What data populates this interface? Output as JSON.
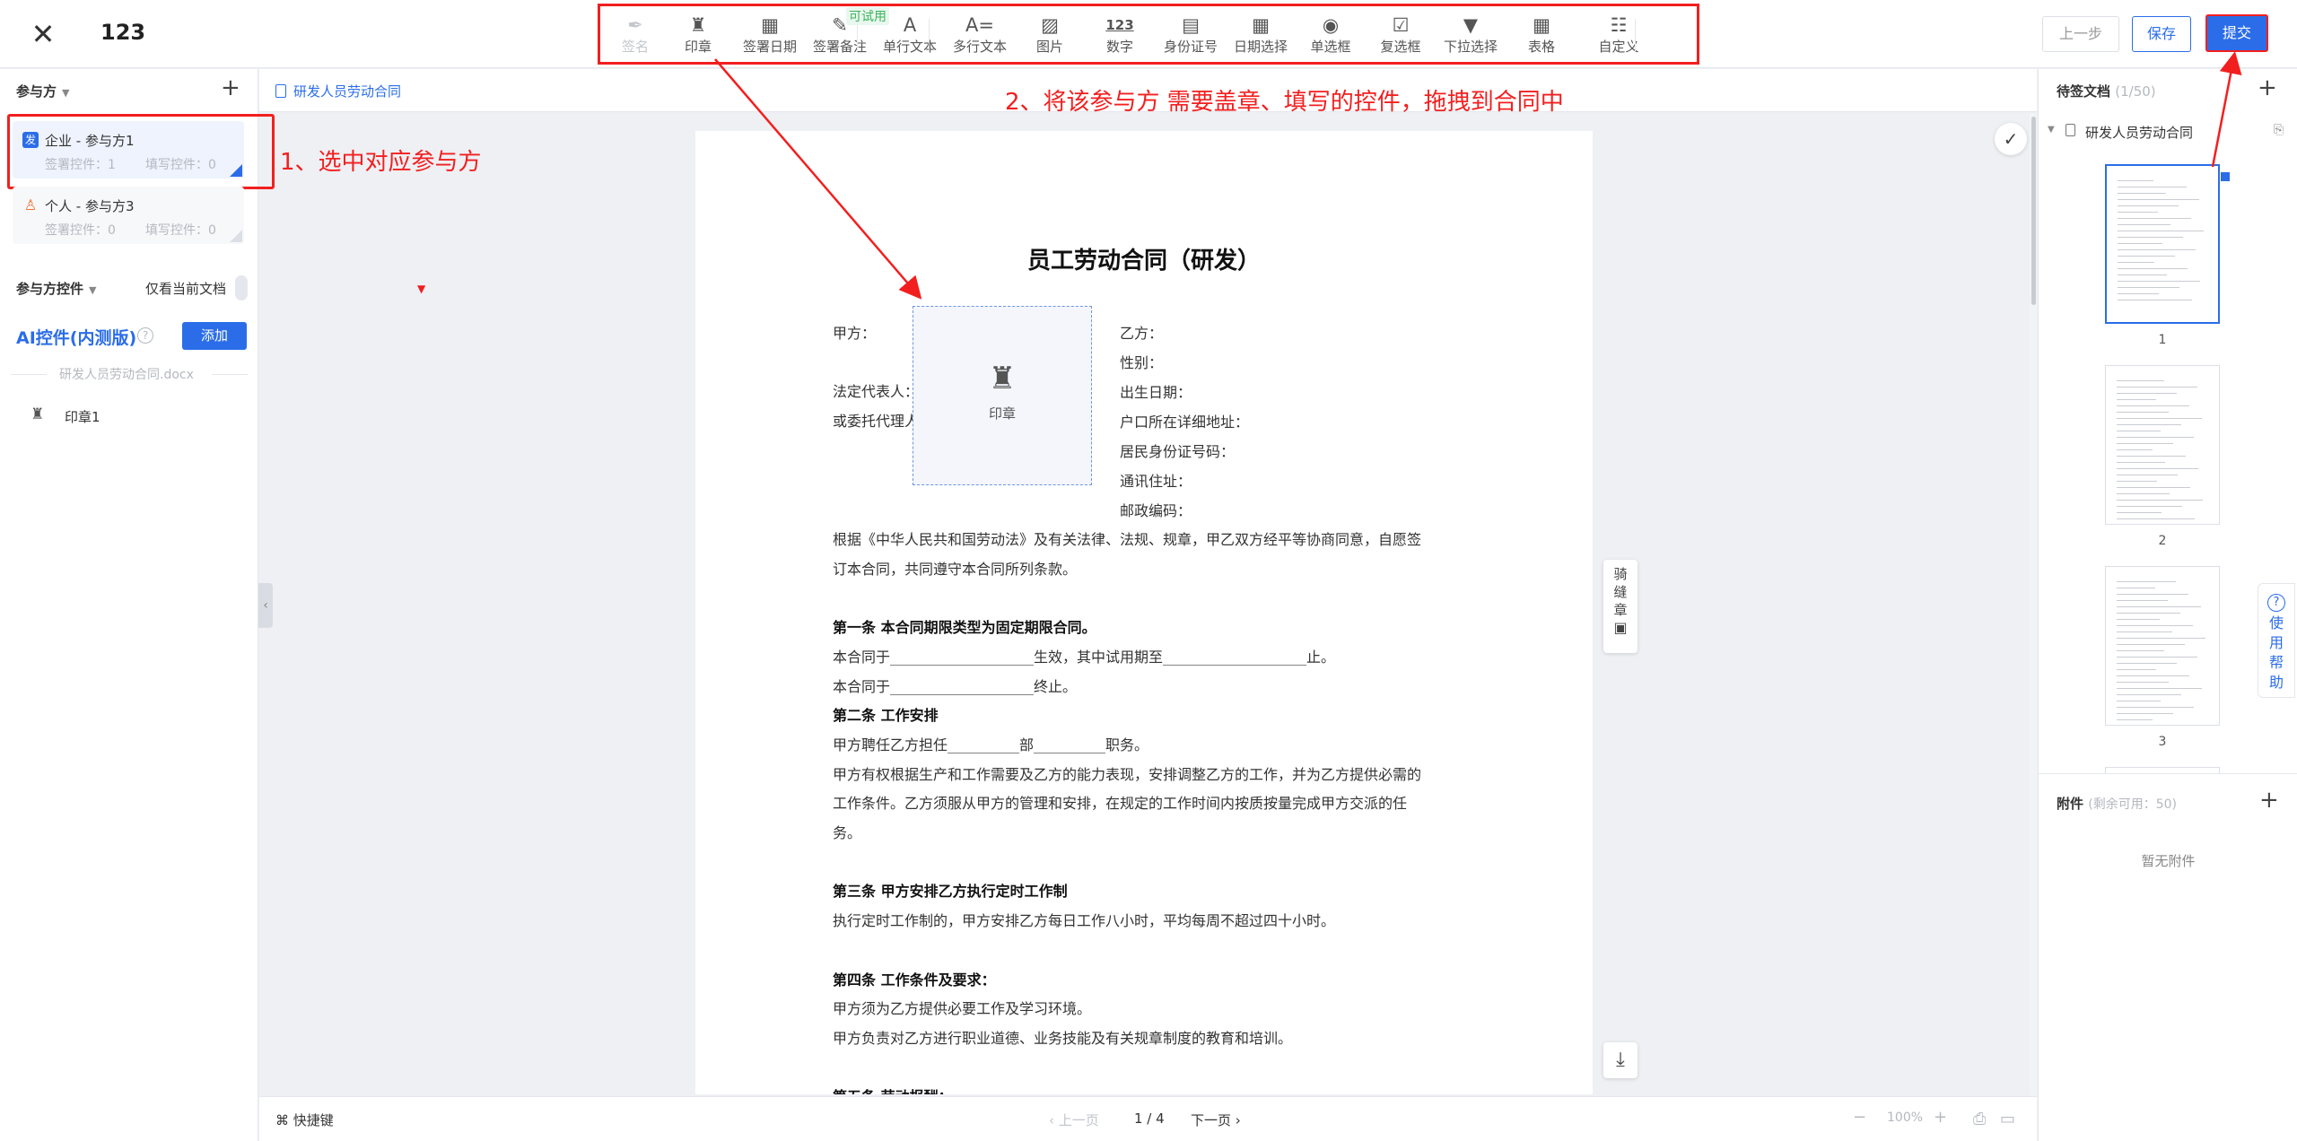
{
  "header": {
    "title": "123",
    "prev_step": "上一步",
    "save": "保存",
    "submit": "提交",
    "trial_badge": "可试用"
  },
  "toolbar": {
    "tools": [
      {
        "name": "tool-signature",
        "label": "签名",
        "icon": "pen-icon",
        "glyph": "✒",
        "disabled": true
      },
      {
        "name": "tool-seal",
        "label": "印章",
        "icon": "seal-icon",
        "glyph": "♜"
      },
      {
        "name": "tool-sign-date",
        "label": "签署日期",
        "icon": "calendar-icon",
        "glyph": "▦"
      },
      {
        "name": "tool-sign-note",
        "label": "签署备注",
        "icon": "note-icon",
        "glyph": "✎"
      },
      {
        "name": "tool-single-text",
        "label": "单行文本",
        "icon": "text-line-icon",
        "glyph": "A"
      },
      {
        "name": "tool-multi-text",
        "label": "多行文本",
        "icon": "text-multi-icon",
        "glyph": "A="
      },
      {
        "name": "tool-image",
        "label": "图片",
        "icon": "image-icon",
        "glyph": "▨"
      },
      {
        "name": "tool-number",
        "label": "数字",
        "icon": "number-icon",
        "glyph": "123"
      },
      {
        "name": "tool-id-number",
        "label": "身份证号",
        "icon": "id-card-icon",
        "glyph": "▤"
      },
      {
        "name": "tool-date-select",
        "label": "日期选择",
        "icon": "date-icon",
        "glyph": "▦"
      },
      {
        "name": "tool-radio",
        "label": "单选框",
        "icon": "radio-icon",
        "glyph": "◉"
      },
      {
        "name": "tool-checkbox",
        "label": "复选框",
        "icon": "checkbox-icon",
        "glyph": "☑"
      },
      {
        "name": "tool-dropdown",
        "label": "下拉选择",
        "icon": "dropdown-icon",
        "glyph": "▼"
      },
      {
        "name": "tool-table",
        "label": "表格",
        "icon": "table-icon",
        "glyph": "▦"
      },
      {
        "name": "tool-custom",
        "label": "自定义",
        "icon": "sliders-icon",
        "glyph": "☷"
      }
    ]
  },
  "left": {
    "parties_title": "参与方",
    "parties": [
      {
        "icon_text": "发",
        "name": "企业 - 参与方1",
        "sign_controls": "签署控件：1",
        "fill_controls": "填写控件：0"
      },
      {
        "icon_text": "♙",
        "name": "个人 - 参与方3",
        "sign_controls": "签署控件：0",
        "fill_controls": "填写控件：0"
      }
    ],
    "controls_title": "参与方控件",
    "only_current": "仅看当前文档",
    "ai_title": "AI控件(内测版)",
    "ai_add": "添加",
    "doc_name": "研发人员劳动合同.docx",
    "seal_item": "印章1"
  },
  "main": {
    "tab": "研发人员劳动合同",
    "annotation_left": "1、选中对应参与方",
    "annotation_top": "2、将该参与方 需要盖章、填写的控件，拖拽到合同中",
    "seam_seal": "骑缝章",
    "seal_box_label": "印章",
    "shortcut": "快捷键",
    "prev_page": "上一页",
    "page_indicator": "1 / 4",
    "next_page": "下一页",
    "zoom": "100%"
  },
  "document": {
    "title": "员工劳动合同（研发）",
    "party_a_fields": [
      "甲方：",
      "法定代表人：",
      "或委托代理人："
    ],
    "party_b_fields": [
      "乙方：",
      "性别：",
      "出生日期：",
      "户口所在详细地址：",
      "居民身份证号码：",
      "通讯住址：",
      "邮政编码："
    ],
    "paragraphs": [
      {
        "text": "根据《中华人民共和国劳动法》及有关法律、法规、规章，甲乙双方经平等协商同意，自愿签",
        "bold": false
      },
      {
        "text": "订本合同，共同遵守本合同所列条款。",
        "bold": false
      },
      {
        "text": "",
        "bold": false
      },
      {
        "text": "第一条   本合同期限类型为固定期限合同。",
        "bold": true
      },
      {
        "text": "本合同于____________________生效，其中试用期至____________________止。",
        "bold": false
      },
      {
        "text": "本合同于____________________终止。",
        "bold": false
      },
      {
        "text": "第二条  工作安排",
        "bold": true
      },
      {
        "text": "甲方聘任乙方担任__________部__________职务。",
        "bold": false
      },
      {
        "text": "甲方有权根据生产和工作需要及乙方的能力表现，安排调整乙方的工作，并为乙方提供必需的",
        "bold": false
      },
      {
        "text": "工作条件。乙方须服从甲方的管理和安排，在规定的工作时间内按质按量完成甲方交派的任",
        "bold": false
      },
      {
        "text": "务。",
        "bold": false
      },
      {
        "text": "",
        "bold": false
      },
      {
        "text": "第三条  甲方安排乙方执行定时工作制",
        "bold": true
      },
      {
        "text": "执行定时工作制的，甲方安排乙方每日工作八小时，平均每周不超过四十小时。",
        "bold": false
      },
      {
        "text": "",
        "bold": false
      },
      {
        "text": "第四条  工作条件及要求：",
        "bold": true
      },
      {
        "text": "甲方须为乙方提供必要工作及学习环境。",
        "bold": false
      },
      {
        "text": "甲方负责对乙方进行职业道德、业务技能及有关规章制度的教育和培训。",
        "bold": false
      },
      {
        "text": "",
        "bold": false
      },
      {
        "text": "第五条   劳动报酬：",
        "bold": true
      }
    ]
  },
  "right": {
    "pending_title": "待签文档",
    "pending_count": "(1/50)",
    "doc_name": "研发人员劳动合同",
    "pages": [
      "1",
      "2",
      "3"
    ],
    "attach_title": "附件",
    "attach_remaining": "(剩余可用：50)",
    "attach_empty": "暂无附件",
    "help": "使用帮助"
  },
  "colors": {
    "accent": "#2b6de8",
    "annotation": "#f21f1f"
  }
}
